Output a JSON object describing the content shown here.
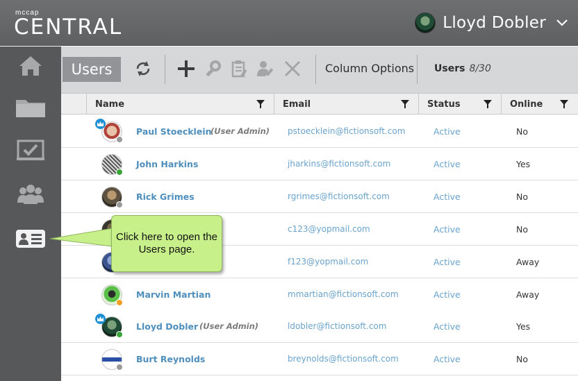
{
  "header": {
    "brand_small": "mccap",
    "brand_big": "CENTRAL",
    "user_name": "Lloyd Dobler"
  },
  "sidebar": {
    "items": [
      {
        "icon": "home-icon"
      },
      {
        "icon": "folder-icon"
      },
      {
        "icon": "checkbox-icon"
      },
      {
        "icon": "group-icon"
      },
      {
        "icon": "user-card-icon"
      }
    ]
  },
  "toolbar": {
    "tab_label": "Users",
    "column_options": "Column Options",
    "users_label": "Users",
    "users_count": "8/30"
  },
  "table": {
    "columns": [
      "Name",
      "Email",
      "Status",
      "Online"
    ],
    "rows": [
      {
        "name": "Paul Stoecklein",
        "tag": "(User Admin)",
        "email": "pstoecklein@fictionsoft.com",
        "status": "Active",
        "online": "No",
        "presence": "offline",
        "admin": true
      },
      {
        "name": "John Harkins",
        "tag": "",
        "email": "jharkins@fictionsoft.com",
        "status": "Active",
        "online": "Yes",
        "presence": "online",
        "admin": false
      },
      {
        "name": "Rick Grimes",
        "tag": "",
        "email": "rgrimes@fictionsoft.com",
        "status": "Active",
        "online": "No",
        "presence": "offline",
        "admin": false
      },
      {
        "name": "",
        "tag": "",
        "email": "c123@yopmail.com",
        "status": "Active",
        "online": "No",
        "presence": "offline",
        "admin": false
      },
      {
        "name": "",
        "tag": "",
        "email": "f123@yopmail.com",
        "status": "Active",
        "online": "Away",
        "presence": "away",
        "admin": false
      },
      {
        "name": "Marvin Martian",
        "tag": "",
        "email": "mmartian@fictionsoft.com",
        "status": "Active",
        "online": "Away",
        "presence": "away",
        "admin": false
      },
      {
        "name": "Lloyd Dobler",
        "tag": "(User Admin)",
        "email": "ldobler@fictionsoft.com",
        "status": "Active",
        "online": "Yes",
        "presence": "online",
        "admin": true
      },
      {
        "name": "Burt Reynolds",
        "tag": "",
        "email": "breynolds@fictionsoft.com",
        "status": "Active",
        "online": "No",
        "presence": "offline",
        "admin": false
      }
    ]
  },
  "callout": {
    "text": "Click here to open the Users page."
  },
  "colors": {
    "link": "#4f8fbd",
    "online": "#3aa63a",
    "away": "#f0a020",
    "offline": "#9a9a9a",
    "callout": "#c8f08a"
  }
}
